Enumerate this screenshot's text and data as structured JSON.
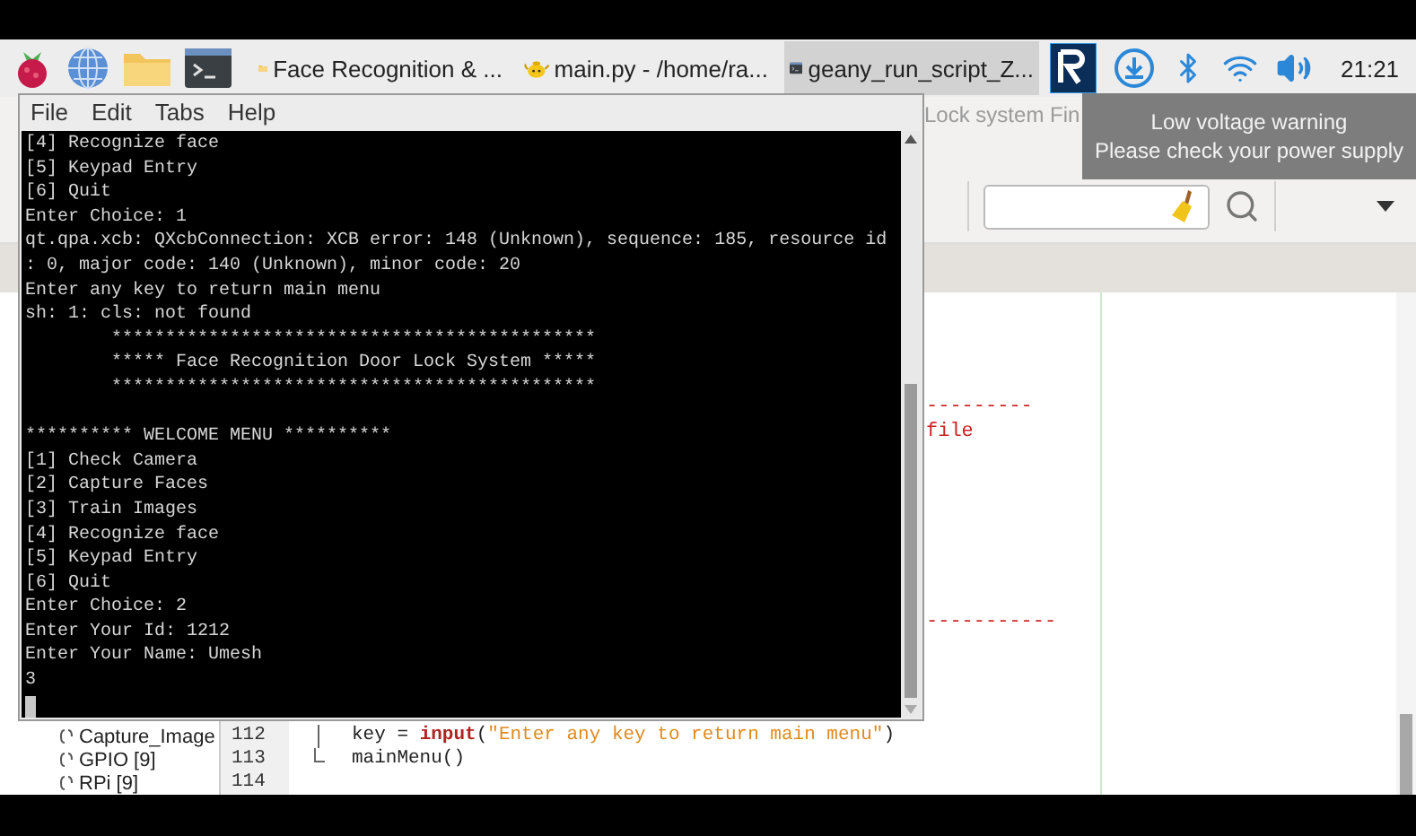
{
  "taskbar": {
    "tasks": [
      {
        "label": "Face Recognition & ...",
        "kind": "folder",
        "selected": false
      },
      {
        "label": "main.py - /home/ra...",
        "kind": "editor",
        "selected": false
      },
      {
        "label": "geany_run_script_Z...",
        "kind": "terminal",
        "selected": true
      }
    ],
    "clock": "21:21"
  },
  "notification": {
    "title": "Low voltage warning",
    "message": "Please check your power supply"
  },
  "editor": {
    "window_title": "Lock system Fin",
    "fragments_top": [
      "---------",
      "file"
    ],
    "fragments_bottom": [
      "-----------"
    ],
    "symbols": [
      "Capture_Image",
      "GPIO [9]",
      "RPi [9]"
    ],
    "lines": [
      {
        "number": "112",
        "kind": "fold-body",
        "tokens": [
          {
            "text": "key = ",
            "kind": "plain"
          },
          {
            "text": "input",
            "kind": "builtin"
          },
          {
            "text": "(",
            "kind": "plain"
          },
          {
            "text": "\"Enter any key to return main menu\"",
            "kind": "string"
          },
          {
            "text": ")",
            "kind": "plain"
          }
        ]
      },
      {
        "number": "113",
        "kind": "fold-end",
        "tokens": [
          {
            "text": "mainMenu()",
            "kind": "plain"
          }
        ]
      },
      {
        "number": "114",
        "kind": "plain"
      }
    ]
  },
  "terminal": {
    "menu": [
      "File",
      "Edit",
      "Tabs",
      "Help"
    ],
    "blocks": [
      [
        "[4] Recognize face",
        "[5] Keypad Entry",
        "[6] Quit",
        "Enter Choice: 1",
        "qt.qpa.xcb: QXcbConnection: XCB error: 148 (Unknown), sequence: 185, resource id",
        ": 0, major code: 140 (Unknown), minor code: 20",
        "Enter any key to return main menu",
        "sh: 1: cls: not found",
        "        *********************************************",
        "        ***** Face Recognition Door Lock System *****",
        "        *********************************************"
      ],
      [
        "********** WELCOME MENU **********",
        "[1] Check Camera",
        "[2] Capture Faces",
        "[3] Train Images",
        "[4] Recognize face",
        "[5] Keypad Entry",
        "[6] Quit",
        "Enter Choice: 2",
        "Enter Your Id: 1212",
        "Enter Your Name: Umesh",
        "3"
      ]
    ]
  }
}
